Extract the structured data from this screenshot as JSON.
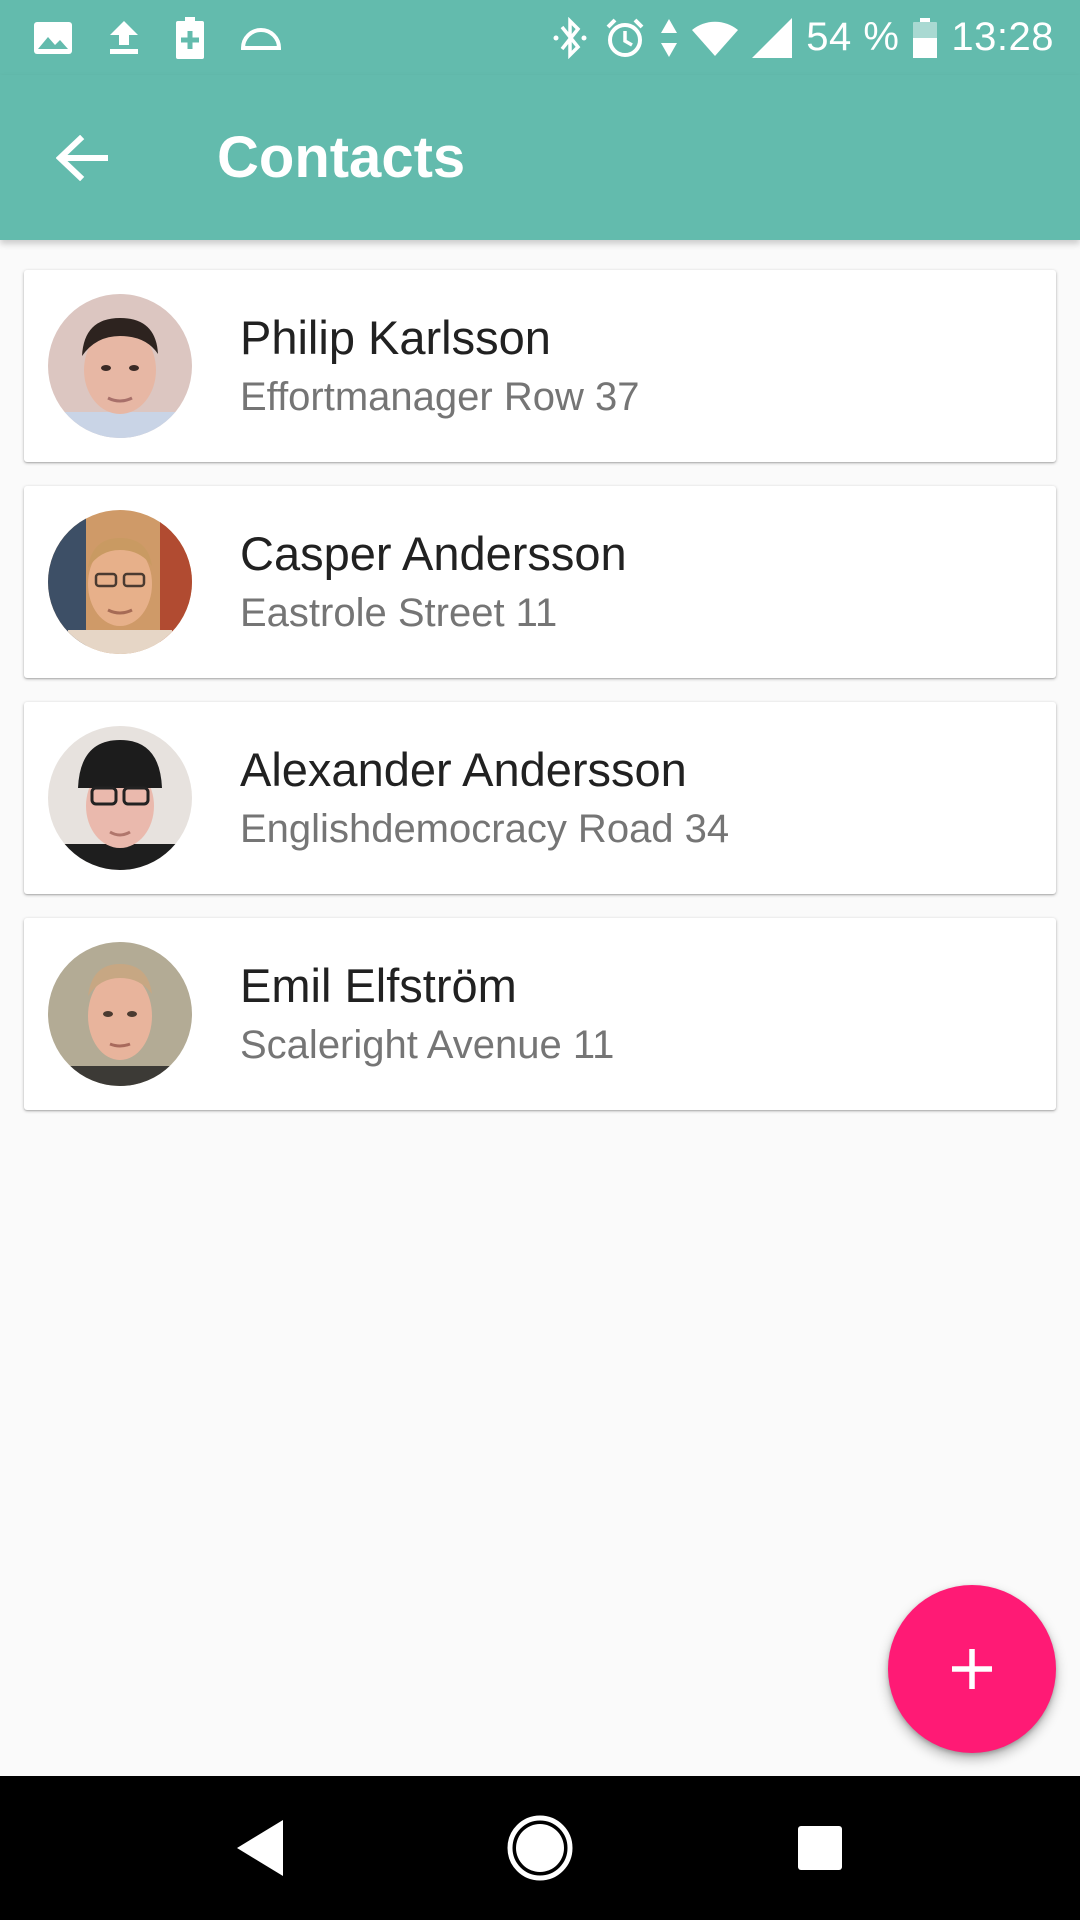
{
  "status_bar": {
    "icons_left": [
      "image-icon",
      "upload-icon",
      "battery-saver-icon",
      "data-icon"
    ],
    "icons_right": [
      "bluetooth-icon",
      "alarm-icon",
      "data-arrows-icon",
      "wifi-icon",
      "cell-signal-icon"
    ],
    "battery_percent": "54 %",
    "time": "13:28"
  },
  "app_bar": {
    "title": "Contacts",
    "back_icon": "arrow-back-icon",
    "color": "#63bbad"
  },
  "contacts": [
    {
      "name": "Philip Karlsson",
      "address": "Effortmanager Row 37"
    },
    {
      "name": "Casper Andersson",
      "address": "Eastrole Street 11"
    },
    {
      "name": "Alexander Andersson",
      "address": "Englishdemocracy Road 34"
    },
    {
      "name": "Emil Elfström",
      "address": "Scaleright Avenue 11"
    }
  ],
  "fab": {
    "icon": "plus-icon",
    "color": "#ff1a75"
  },
  "nav_bar": {
    "icons": [
      "nav-back-icon",
      "nav-home-icon",
      "nav-recents-icon"
    ]
  }
}
